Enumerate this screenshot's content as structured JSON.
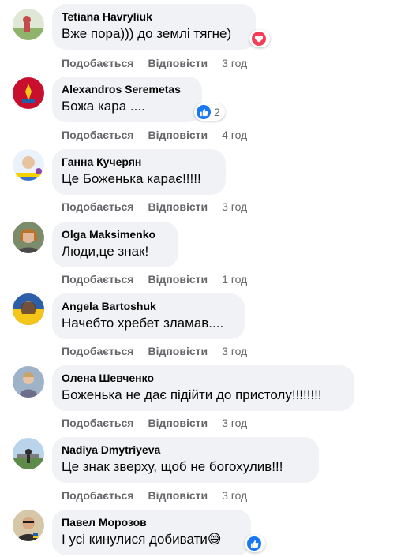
{
  "comments": [
    {
      "author": "Tetiana Havryliuk",
      "text": "Вже пора))) до землі тягне)",
      "like_label": "Подобається",
      "reply_label": "Відповісти",
      "time": "3 год",
      "reaction": "love-icon",
      "reaction_count": ""
    },
    {
      "author": "Alexandros Seremetas",
      "text": "Божа кара ....",
      "like_label": "Подобається",
      "reply_label": "Відповісти",
      "time": "4 год",
      "reaction": "like-icon",
      "reaction_count": "2"
    },
    {
      "author": "Ганна Кучерян",
      "text": "Це Боженька карає!!!!!",
      "like_label": "Подобається",
      "reply_label": "Відповісти",
      "time": "3 год"
    },
    {
      "author": "Olga Maksimenko",
      "text": "Люди,це знак!",
      "like_label": "Подобається",
      "reply_label": "Відповісти",
      "time": "1 год"
    },
    {
      "author": "Angela Bartoshuk",
      "text": "Начебто хребет зламав....",
      "like_label": "Подобається",
      "reply_label": "Відповісти",
      "time": "3 год"
    },
    {
      "author": "Олена Шевченко",
      "text": "Боженька не дає підійти до пристолу!!!!!!!!",
      "like_label": "Подобається",
      "reply_label": "Відповісти",
      "time": "3 год"
    },
    {
      "author": "Nadiya Dmytriyeva",
      "text": "Це знак зверху, щоб не богохулив!!!",
      "like_label": "Подобається",
      "reply_label": "Відповісти",
      "time": "3 год"
    },
    {
      "author": "Павел Морозов",
      "text": "І усі кинулися добивати",
      "emoji": "😅",
      "reaction": "like-icon",
      "reaction_count": ""
    }
  ],
  "colors": {
    "bubble": "#f0f2f5",
    "secondary_text": "#65676b",
    "like_blue": "#1877f2",
    "love_red": "#f33e58"
  }
}
